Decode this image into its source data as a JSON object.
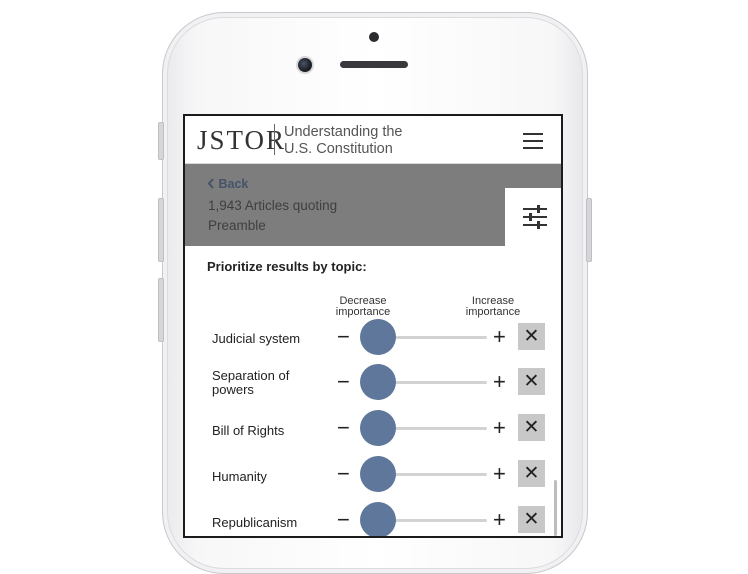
{
  "app": {
    "logo_text": "JSTOR",
    "subtitle_line1": "Understanding the",
    "subtitle_line2": "U.S. Constitution"
  },
  "header": {
    "menu_icon": "hamburger-menu-icon"
  },
  "results": {
    "back_label": "Back",
    "back_icon": "chevron-left-icon",
    "count_line": "1,943 Articles quoting",
    "term_line": "Preamble",
    "filter_icon": "sliders-icon"
  },
  "prioritize": {
    "heading": "Prioritize results by topic:",
    "decrease_label": [
      "Decrease",
      "importance"
    ],
    "increase_label": [
      "Increase",
      "importance"
    ],
    "minus_symbol": "−",
    "plus_symbol": "+",
    "remove_symbol": "✕",
    "topics": [
      {
        "label_lines": [
          "Judicial system"
        ]
      },
      {
        "label_lines": [
          "Separation of",
          "powers"
        ]
      },
      {
        "label_lines": [
          "Bill of Rights"
        ]
      },
      {
        "label_lines": [
          "Humanity"
        ]
      },
      {
        "label_lines": [
          "Republicanism"
        ]
      }
    ]
  },
  "colors": {
    "slider_knob": "#5e779a",
    "overlay": "#7d7d7d",
    "back_link": "#44536a"
  }
}
